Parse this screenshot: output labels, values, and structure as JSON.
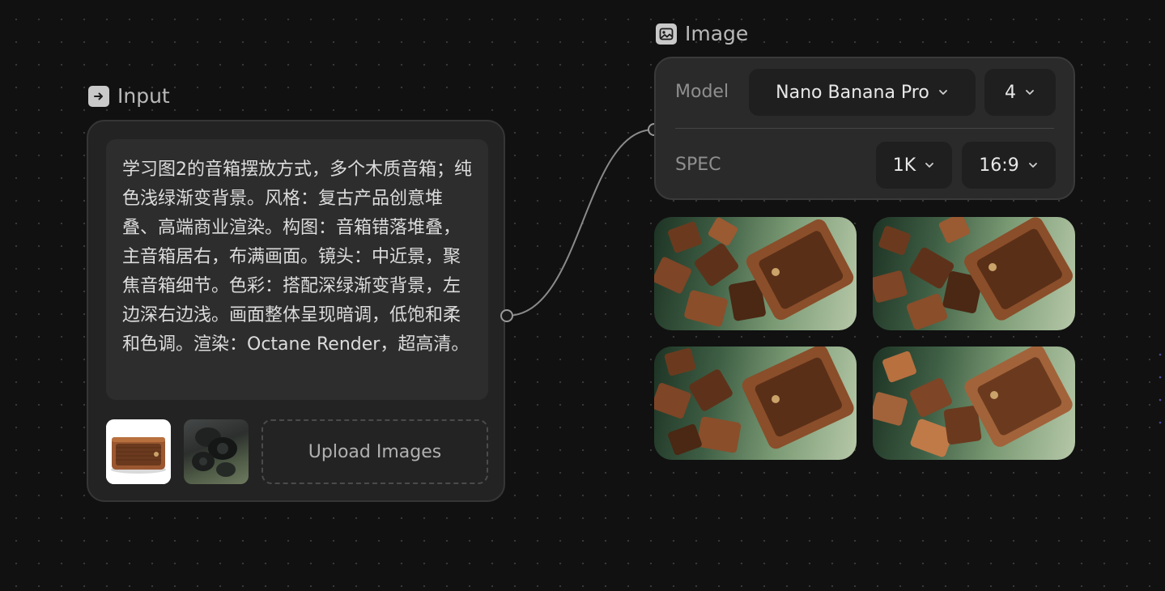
{
  "input_node": {
    "title": "Input",
    "icon": "arrow-right-box-icon",
    "prompt_text": "学习图2的音箱摆放方式，多个木质音箱；纯色浅绿渐变背景。风格：复古产品创意堆叠、高端商业渲染。构图：音箱错落堆叠，主音箱居右，布满画面。镜头：中近景，聚焦音箱细节。色彩：搭配深绿渐变背景，左边深右边浅。画面整体呈现暗调，低饱和柔和色调。渲染：Octane Render，超高清。",
    "reference_images": [
      "wooden-speaker-product-photo",
      "dark-stacked-speakers-photo"
    ],
    "upload_label": "Upload Images"
  },
  "image_node": {
    "title": "Image",
    "icon": "image-icon",
    "model_label": "Model",
    "model_value": "Nano Banana Pro",
    "count_value": "4",
    "spec_label": "SPEC",
    "resolution_value": "1K",
    "aspect_value": "16:9",
    "outputs": [
      "generated-image-1",
      "generated-image-2",
      "generated-image-3",
      "generated-image-4"
    ]
  },
  "colors": {
    "canvas_bg": "#111111",
    "node_bg": "#232323",
    "field_bg": "#2d2d2d",
    "accent_green": "#7a9a74",
    "wood": "#8a4e2a"
  }
}
